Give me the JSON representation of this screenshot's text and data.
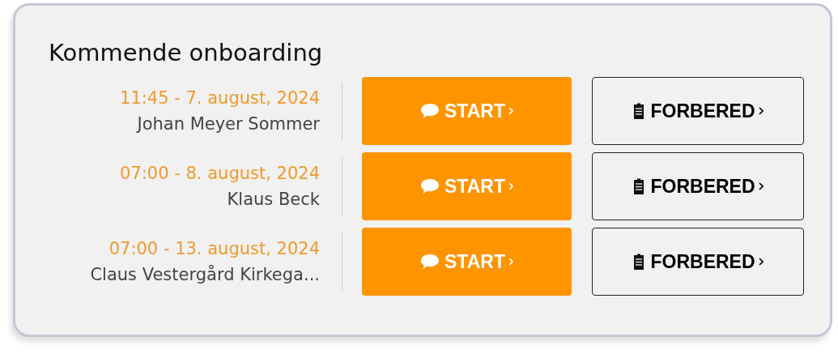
{
  "card": {
    "title": "Kommende onboarding"
  },
  "sessions": [
    {
      "datetime": "11:45 - 7. august, 2024",
      "name": "Johan Meyer Sommer",
      "start_label": "START",
      "prepare_label": "FORBERED"
    },
    {
      "datetime": "07:00 - 8. august, 2024",
      "name": "Klaus Beck",
      "start_label": "START",
      "prepare_label": "FORBERED"
    },
    {
      "datetime": "07:00 - 13. august, 2024",
      "name": "Claus Vestergård Kirkega...",
      "start_label": "START",
      "prepare_label": "FORBERED"
    }
  ]
}
